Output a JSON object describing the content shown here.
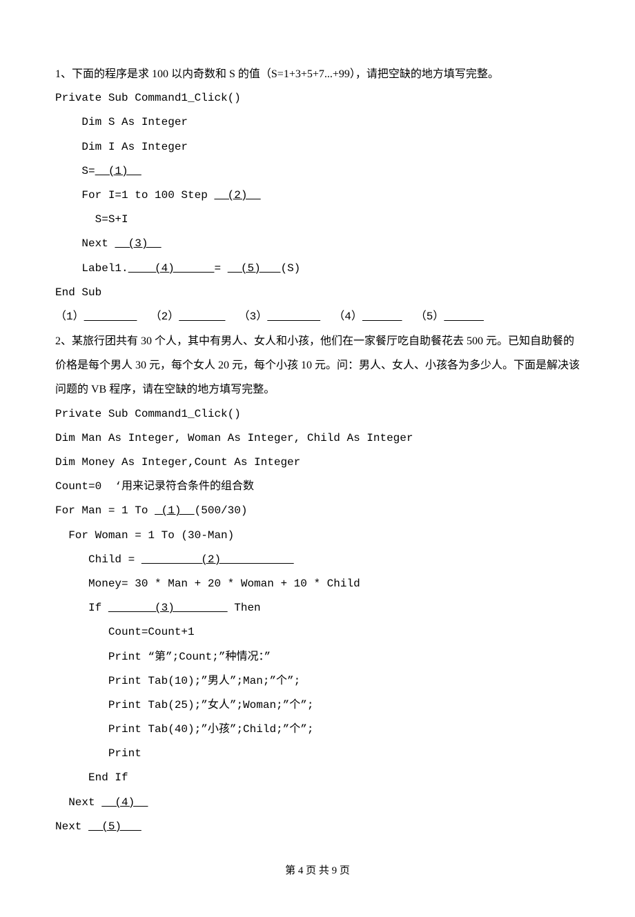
{
  "q1": {
    "title": "1、下面的程序是求 100 以内奇数和 S 的值（S=1+3+5+7...+99），请把空缺的地方填写完整。",
    "l1": "Private Sub Command1_Click()",
    "l2": "    Dim S As Integer",
    "l3": "    Dim I As Integer",
    "l4a": "    S=",
    "l4b": "  (1)  ",
    "l5a": "    For I=1 to 100 Step ",
    "l5b": "  (2)  ",
    "l6": "      S=S+I",
    "l7a": "    Next ",
    "l7b": "  (3)  ",
    "l8a": "    Label1.",
    "l8b": "    (4)      ",
    "l8c": "= ",
    "l8d": "  (5)   ",
    "l8e": "(S)",
    "l9": "End Sub",
    "ans_a": "（1）",
    "ans_b": "        ",
    "ans_c": "  （2）",
    "ans_d": "       ",
    "ans_e": "  （3）",
    "ans_f": "        ",
    "ans_g": "  （4）",
    "ans_h": "      ",
    "ans_i": "  （5）",
    "ans_j": "      "
  },
  "q2": {
    "p1": "2、某旅行团共有 30 个人，其中有男人、女人和小孩，他们在一家餐厅吃自助餐花去 500 元。已知自助餐的价格是每个男人 30 元，每个女人 20 元，每个小孩 10 元。问：男人、女人、小孩各为多少人。下面是解决该问题的 VB 程序，请在空缺的地方填写完整。",
    "l1": "Private Sub Command1_Click()",
    "l2": "Dim Man As Integer, Woman As Integer, Child As Integer",
    "l3": "Dim Money As Integer,Count As Integer",
    "l4": "Count=0  ‘用来记录符合条件的组合数",
    "l5a": "For Man = 1 To ",
    "l5b": " (1)  ",
    "l5c": "(500/30)",
    "l6": "  For Woman = 1 To (30-Man)",
    "l7a": "     Child = ",
    "l7b": "         (2)           ",
    "l8": "     Money= 30 * Man + 20 * Woman + 10 * Child",
    "l9a": "     If ",
    "l9b": "       (3)        ",
    "l9c": " Then",
    "l10": "        Count=Count+1",
    "l11": "        Print “第”;Count;”种情况：”",
    "l12": "        Print Tab(10);”男人”;Man;”个”;",
    "l13": "        Print Tab(25);”女人”;Woman;”个”;",
    "l14": "        Print Tab(40);”小孩”;Child;”个”;",
    "l15": "        Print",
    "l16": "     End If",
    "l17a": "  Next ",
    "l17b": "  (4)  ",
    "l18a": "Next ",
    "l18b": "  (5)   "
  },
  "footer": "第 4 页 共 9 页"
}
